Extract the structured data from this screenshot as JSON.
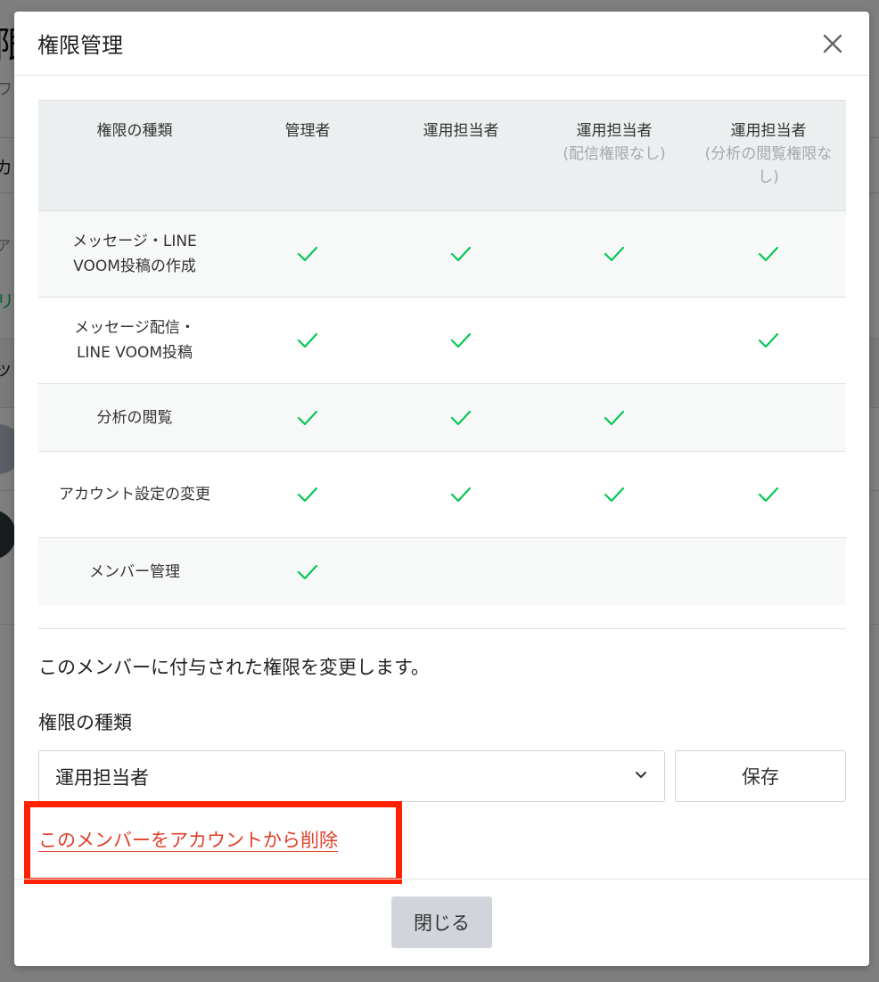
{
  "background_page": {
    "title_partial": "限",
    "subtitle_partial": "ワン",
    "label_a_partial": "カ",
    "label_b_partial": "ア",
    "link_partial": "リ",
    "table_head_partial": "ッ"
  },
  "modal": {
    "title": "権限管理",
    "close_icon": "close-icon",
    "table": {
      "headers": [
        {
          "main": "権限の種類",
          "note": ""
        },
        {
          "main": "管理者",
          "note": ""
        },
        {
          "main": "運用担当者",
          "note": ""
        },
        {
          "main": "運用担当者",
          "note": "(配信権限なし)"
        },
        {
          "main": "運用担当者",
          "note": "(分析の閲覧権限なし)"
        }
      ],
      "rows": [
        {
          "label": "メッセージ・LINE VOOM投稿の作成",
          "checks": [
            true,
            true,
            true,
            true
          ]
        },
        {
          "label": "メッセージ配信・LINE VOOM投稿",
          "checks": [
            true,
            true,
            false,
            true
          ]
        },
        {
          "label": "分析の閲覧",
          "checks": [
            true,
            true,
            true,
            false
          ]
        },
        {
          "label": "アカウント設定の変更",
          "checks": [
            true,
            true,
            true,
            true
          ]
        },
        {
          "label": "メンバー管理",
          "checks": [
            true,
            false,
            false,
            false
          ]
        }
      ],
      "check_color": "#06c755"
    },
    "description": "このメンバーに付与された権限を変更します。",
    "role_field": {
      "label": "権限の種類",
      "selected_value": "運用担当者",
      "chevron_icon": "chevron-down-icon"
    },
    "save_label": "保存",
    "remove_link": "このメンバーをアカウントから削除",
    "remove_link_color": "#e0402a",
    "highlight_color": "#ff2200",
    "close_button_label": "閉じる"
  }
}
